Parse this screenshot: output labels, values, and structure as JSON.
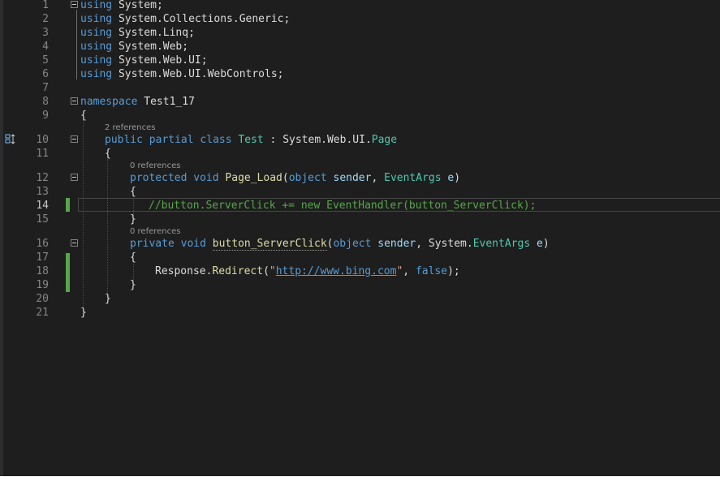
{
  "editor": {
    "line_numbers": [
      "1",
      "2",
      "3",
      "4",
      "5",
      "6",
      "7",
      "8",
      "9",
      "10",
      "11",
      "12",
      "13",
      "14",
      "15",
      "16",
      "17",
      "18",
      "19",
      "20",
      "21"
    ],
    "current_line": "14",
    "codelens": {
      "class_refs": "2 references",
      "page_load_refs": "0 references",
      "click_refs": "0 references"
    },
    "usings": {
      "kw": "using",
      "l1": "System",
      "l2a": "System",
      "l2b": "Collections",
      "l2c": "Generic",
      "l3a": "System",
      "l3b": "Linq",
      "l4a": "System",
      "l4b": "Web",
      "l5a": "System",
      "l5b": "Web",
      "l5c": "UI",
      "l6a": "System",
      "l6b": "Web",
      "l6c": "UI",
      "l6d": "WebControls"
    },
    "namespace": {
      "kw": "namespace",
      "name": "Test1_17"
    },
    "class_decl": {
      "kw1": "public",
      "kw2": "partial",
      "kw3": "class",
      "name": "Test",
      "base_a": "System",
      "base_b": "Web",
      "base_c": "UI",
      "base_d": "Page"
    },
    "page_load": {
      "kw1": "protected",
      "kw2": "void",
      "name": "Page_Load",
      "ptype1": "object",
      "pname1": "sender",
      "ptype2": "EventArgs",
      "pname2": "e"
    },
    "comment": "//button.ServerClick += new EventHandler(button_ServerClick);",
    "click_method": {
      "kw1": "private",
      "kw2": "void",
      "name": "button_ServerClick",
      "ptype1": "object",
      "pname1": "sender",
      "ptype2a": "System",
      "ptype2b": "EventArgs",
      "pname2": "e"
    },
    "redirect": {
      "obj": "Response",
      "method": "Redirect",
      "url": "http://www.bing.com",
      "arg2": "false"
    },
    "colors": {
      "background": "#1e1e1e",
      "keyword": "#569cd6",
      "type": "#4ec9b0",
      "method": "#dcdcaa",
      "comment": "#57a64a",
      "string": "#d69d85",
      "change_bar": "#57a64a"
    }
  }
}
